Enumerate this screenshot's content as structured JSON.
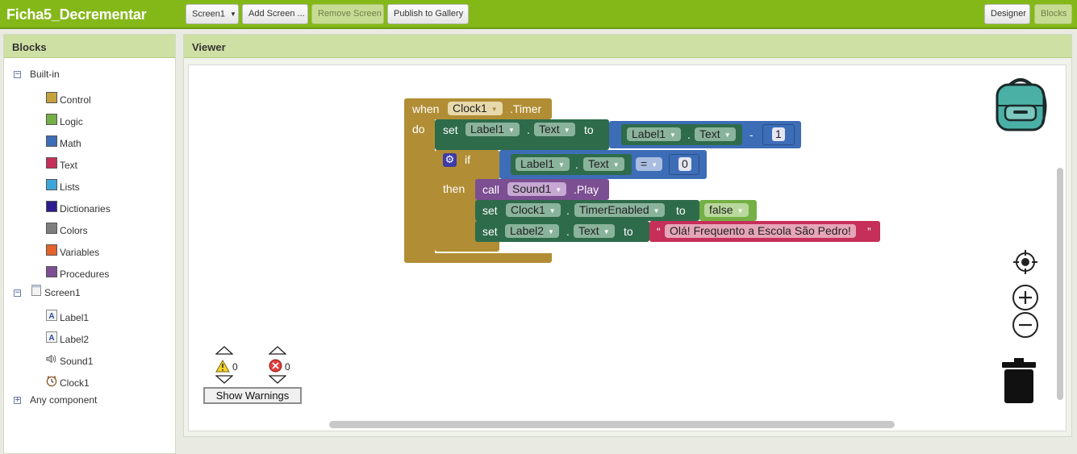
{
  "app": {
    "title": "Ficha5_Decrementar"
  },
  "toolbar": {
    "screen_select": "Screen1",
    "add_screen": "Add Screen ...",
    "remove_screen": "Remove Screen",
    "publish": "Publish to Gallery",
    "designer": "Designer",
    "blocks": "Blocks"
  },
  "blocks_panel": {
    "title": "Blocks",
    "builtin": {
      "label": "Built-in",
      "items": [
        {
          "label": "Control",
          "color": "#c6a23e"
        },
        {
          "label": "Logic",
          "color": "#74b045"
        },
        {
          "label": "Math",
          "color": "#3d6db6"
        },
        {
          "label": "Text",
          "color": "#c62f59"
        },
        {
          "label": "Lists",
          "color": "#3ba6d9"
        },
        {
          "label": "Dictionaries",
          "color": "#2c1a8f"
        },
        {
          "label": "Colors",
          "color": "#7e7e7e"
        },
        {
          "label": "Variables",
          "color": "#e4622b"
        },
        {
          "label": "Procedures",
          "color": "#7c4e92"
        }
      ]
    },
    "screen": {
      "label": "Screen1",
      "components": [
        {
          "label": "Label1",
          "icon": "label-icon"
        },
        {
          "label": "Label2",
          "icon": "label-icon"
        },
        {
          "label": "Sound1",
          "icon": "sound-icon"
        },
        {
          "label": "Clock1",
          "icon": "clock-icon"
        }
      ]
    },
    "any_component": "Any component"
  },
  "viewer": {
    "title": "Viewer",
    "event_block": {
      "when": "when",
      "component": "Clock1",
      "event": ".Timer",
      "do": "do"
    },
    "set_label1": {
      "set": "set",
      "component": "Label1",
      "dot": ".",
      "property": "Text",
      "to": "to",
      "operand_component": "Label1",
      "operand_property": "Text",
      "operator": "-",
      "number": "1"
    },
    "if_block": {
      "if": "if",
      "component": "Label1",
      "property": "Text",
      "operator": "=",
      "number": "0",
      "then": "then"
    },
    "call_block": {
      "call": "call",
      "component": "Sound1",
      "method": ".Play"
    },
    "set_clock": {
      "set": "set",
      "component": "Clock1",
      "property": "TimerEnabled",
      "to": "to",
      "value": "false"
    },
    "set_label2": {
      "set": "set",
      "component": "Label2",
      "property": "Text",
      "to": "to",
      "open_quote": "“",
      "value": "Olá! Frequento a Escola São Pedro!",
      "close_quote": "”"
    },
    "warnings": {
      "warning_count": "0",
      "error_count": "0",
      "button": "Show Warnings"
    }
  }
}
